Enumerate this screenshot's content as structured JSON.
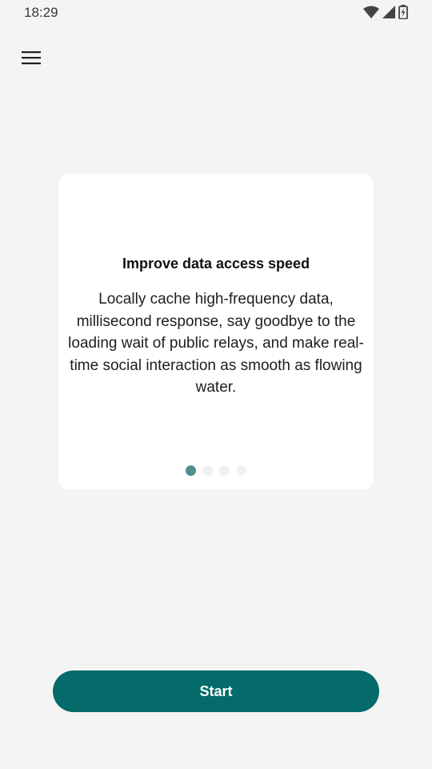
{
  "status_bar": {
    "time": "18:29",
    "icons": [
      "wifi-icon",
      "signal-icon",
      "battery-icon"
    ]
  },
  "header": {
    "menu_icon": "hamburger-menu-icon"
  },
  "onboarding": {
    "title": "Improve data access speed",
    "body": "Locally cache high-frequency data, millisecond response, say goodbye to the loading wait of public relays, and make real-time social interaction as smooth as flowing water.",
    "page_count": 4,
    "active_page": 1
  },
  "actions": {
    "start_label": "Start"
  },
  "colors": {
    "background": "#f4f4f4",
    "card": "#ffffff",
    "accent": "#046a6a",
    "dot_active": "#4f8e8e",
    "dot_inactive": "#f0f2f2"
  }
}
